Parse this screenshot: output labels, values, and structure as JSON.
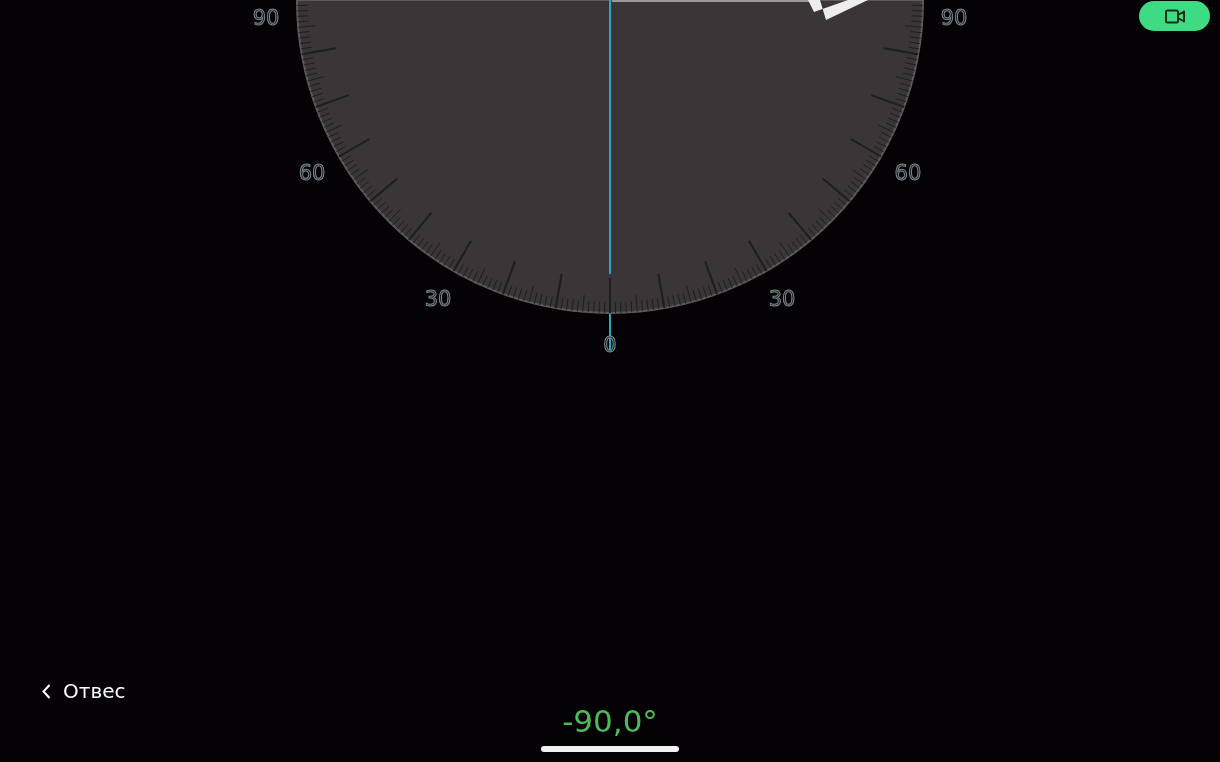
{
  "record_button": {
    "kind": "video"
  },
  "scale_labels": [
    "90",
    "60",
    "30",
    "0",
    "30",
    "60",
    "90"
  ],
  "back_link": {
    "label": "Отвес"
  },
  "reading": "-90,0°"
}
